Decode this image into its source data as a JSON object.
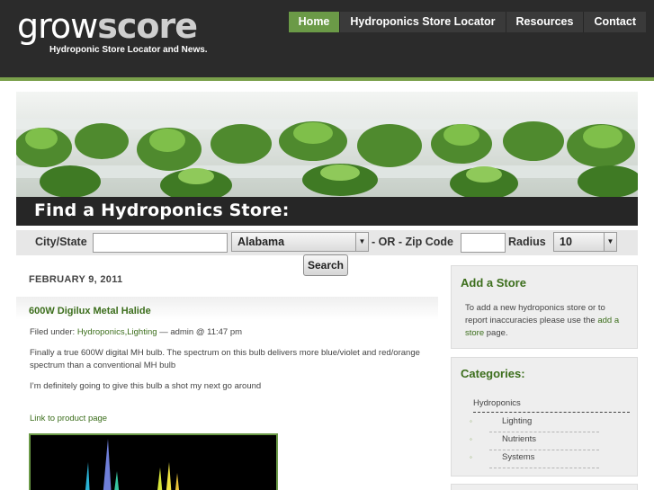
{
  "header": {
    "logo_grow": "grow",
    "logo_score": "score",
    "tagline": "Hydroponic Store Locator and News.",
    "nav": [
      {
        "label": "Home",
        "active": true
      },
      {
        "label": "Hydroponics Store Locator",
        "active": false
      },
      {
        "label": "Resources",
        "active": false
      },
      {
        "label": "Contact",
        "active": false
      }
    ]
  },
  "banner": {
    "title": "Find a Hydroponics Store:"
  },
  "search": {
    "city_label": "City/State",
    "city_value": "",
    "state_selected": "Alabama",
    "or_label": "- OR - Zip Code",
    "zip_value": "",
    "radius_label": "Radius",
    "radius_selected": "10",
    "button_label": "Search"
  },
  "post": {
    "date": "FEBRUARY 9, 2011",
    "title": "600W Digilux Metal Halide",
    "filed_prefix": "Filed under:",
    "filed_category": "Hydroponics,Lighting",
    "filed_suffix": "— admin @ 11:47 pm",
    "para1": "Finally a true 600W digital MH bulb. The spectrum on this bulb delivers more blue/violet and red/orange spectrum than a conventional MH bulb",
    "para2": "I’m definitely going to give this bulb a shot my next go around",
    "link_label": "Link to product page"
  },
  "sidebar": {
    "add_store": {
      "title": "Add a Store",
      "text_before": "To add a new hydroponics store or to report inaccuracies please use the",
      "link": "add a store",
      "text_after": "page."
    },
    "categories": {
      "title": "Categories:",
      "root": "Hydroponics",
      "items": [
        "Lighting",
        "Nutrients",
        "Systems"
      ]
    }
  },
  "colors": {
    "header_bg": "#2b2b2b",
    "accent_green": "#6b9a47",
    "link_green": "#3c6e1c"
  }
}
